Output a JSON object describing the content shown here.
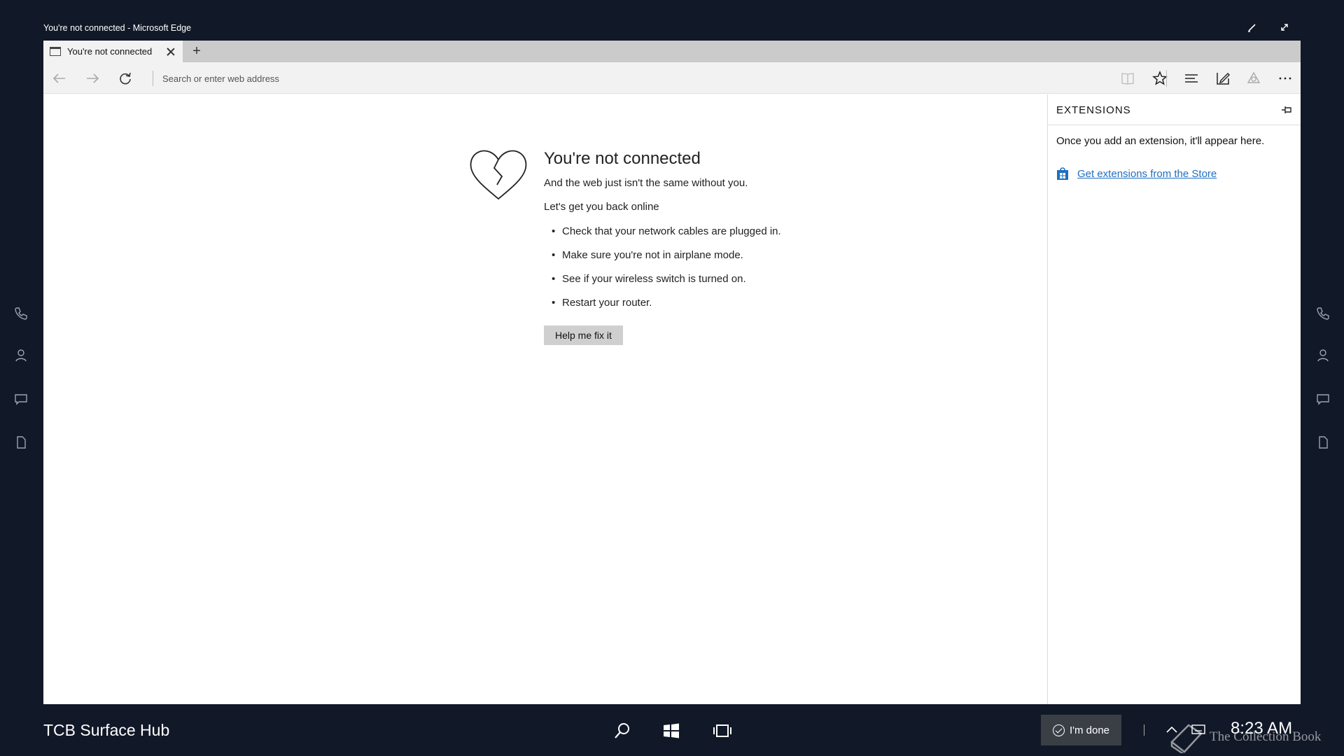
{
  "window": {
    "title": "You're not connected - Microsoft Edge"
  },
  "tabs": [
    {
      "label": "You're not connected"
    }
  ],
  "toolbar": {
    "address_placeholder": "Search or enter web address"
  },
  "error_page": {
    "title": "You're not connected",
    "subtitle": "And the web just isn't the same without you.",
    "lead": "Let's get you back online",
    "tips": [
      "Check that your network cables are plugged in.",
      "Make sure you're not in airplane mode.",
      "See if your wireless switch is turned on.",
      "Restart your router."
    ],
    "fix_button": "Help me fix it"
  },
  "extensions": {
    "title": "EXTENSIONS",
    "empty_message": "Once you add an extension, it'll appear here.",
    "store_link": "Get extensions from the Store"
  },
  "taskbar": {
    "hub_name": "TCB Surface Hub",
    "done_button": "I'm done",
    "clock": "8:23 AM"
  },
  "watermark": "The Collection Book",
  "colors": {
    "desktop": "#111827",
    "link": "#1f6fbf",
    "tabstrip": "#cbcbcb",
    "toolbar": "#f2f2f2"
  }
}
